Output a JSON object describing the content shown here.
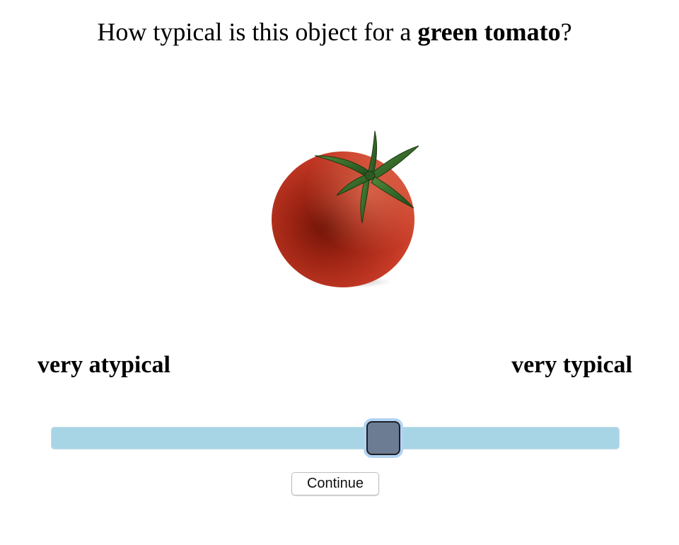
{
  "question": {
    "prefix": "How typical is this object for a ",
    "target": "green tomato",
    "suffix": "?"
  },
  "stimulus": {
    "name": "tomato-image"
  },
  "scale": {
    "left_label": "very atypical",
    "right_label": "very typical",
    "value": 0.585
  },
  "continue_button": {
    "label": "Continue"
  },
  "colors": {
    "track": "#a8d5e6",
    "handle": "#6c7c93",
    "handle_focus_ring": "#b2d3f2"
  }
}
